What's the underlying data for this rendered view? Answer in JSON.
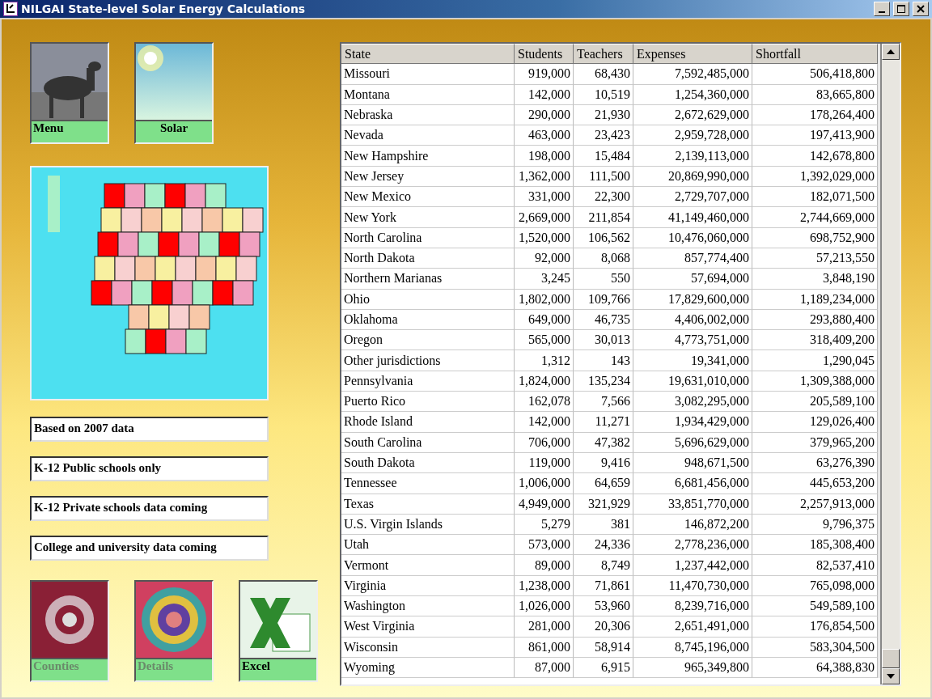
{
  "window": {
    "title": "NILGAI State-level Solar Energy Calculations"
  },
  "top_tiles": [
    {
      "label": "Menu",
      "kind": "animal",
      "disabled": false
    },
    {
      "label": "Solar",
      "kind": "sun",
      "disabled": false
    }
  ],
  "notes": [
    "Based on 2007 data",
    "K-12 Public schools only",
    "K-12 Private schools data coming",
    "College and university data coming"
  ],
  "bottom_tiles": [
    {
      "label": "Counties",
      "kind": "fractal",
      "disabled": true
    },
    {
      "label": "Details",
      "kind": "spiral",
      "disabled": true
    },
    {
      "label": "Excel",
      "kind": "spreadsheet",
      "disabled": false
    }
  ],
  "table": {
    "columns": [
      "State",
      "Students",
      "Teachers",
      "Expenses",
      "Shortfall"
    ],
    "rows": [
      [
        "Missouri",
        "919,000",
        "68,430",
        "7,592,485,000",
        "506,418,800"
      ],
      [
        "Montana",
        "142,000",
        "10,519",
        "1,254,360,000",
        "83,665,800"
      ],
      [
        "Nebraska",
        "290,000",
        "21,930",
        "2,672,629,000",
        "178,264,400"
      ],
      [
        "Nevada",
        "463,000",
        "23,423",
        "2,959,728,000",
        "197,413,900"
      ],
      [
        "New Hampshire",
        "198,000",
        "15,484",
        "2,139,113,000",
        "142,678,800"
      ],
      [
        "New Jersey",
        "1,362,000",
        "111,500",
        "20,869,990,000",
        "1,392,029,000"
      ],
      [
        "New Mexico",
        "331,000",
        "22,300",
        "2,729,707,000",
        "182,071,500"
      ],
      [
        "New York",
        "2,669,000",
        "211,854",
        "41,149,460,000",
        "2,744,669,000"
      ],
      [
        "North Carolina",
        "1,520,000",
        "106,562",
        "10,476,060,000",
        "698,752,900"
      ],
      [
        "North Dakota",
        "92,000",
        "8,068",
        "857,774,400",
        "57,213,550"
      ],
      [
        "Northern Marianas",
        "3,245",
        "550",
        "57,694,000",
        "3,848,190"
      ],
      [
        "Ohio",
        "1,802,000",
        "109,766",
        "17,829,600,000",
        "1,189,234,000"
      ],
      [
        "Oklahoma",
        "649,000",
        "46,735",
        "4,406,002,000",
        "293,880,400"
      ],
      [
        "Oregon",
        "565,000",
        "30,013",
        "4,773,751,000",
        "318,409,200"
      ],
      [
        "Other jurisdictions",
        "1,312",
        "143",
        "19,341,000",
        "1,290,045"
      ],
      [
        "Pennsylvania",
        "1,824,000",
        "135,234",
        "19,631,010,000",
        "1,309,388,000"
      ],
      [
        "Puerto Rico",
        "162,078",
        "7,566",
        "3,082,295,000",
        "205,589,100"
      ],
      [
        "Rhode Island",
        "142,000",
        "11,271",
        "1,934,429,000",
        "129,026,400"
      ],
      [
        "South Carolina",
        "706,000",
        "47,382",
        "5,696,629,000",
        "379,965,200"
      ],
      [
        "South Dakota",
        "119,000",
        "9,416",
        "948,671,500",
        "63,276,390"
      ],
      [
        "Tennessee",
        "1,006,000",
        "64,659",
        "6,681,456,000",
        "445,653,200"
      ],
      [
        "Texas",
        "4,949,000",
        "321,929",
        "33,851,770,000",
        "2,257,913,000"
      ],
      [
        "U.S. Virgin Islands",
        "5,279",
        "381",
        "146,872,200",
        "9,796,375"
      ],
      [
        "Utah",
        "573,000",
        "24,336",
        "2,778,236,000",
        "185,308,400"
      ],
      [
        "Vermont",
        "89,000",
        "8,749",
        "1,237,442,000",
        "82,537,410"
      ],
      [
        "Virginia",
        "1,238,000",
        "71,861",
        "11,470,730,000",
        "765,098,000"
      ],
      [
        "Washington",
        "1,026,000",
        "53,960",
        "8,239,716,000",
        "549,589,100"
      ],
      [
        "West Virginia",
        "281,000",
        "20,306",
        "2,651,491,000",
        "176,854,500"
      ],
      [
        "Wisconsin",
        "861,000",
        "58,914",
        "8,745,196,000",
        "583,304,500"
      ],
      [
        "Wyoming",
        "87,000",
        "6,915",
        "965,349,800",
        "64,388,830"
      ]
    ]
  }
}
